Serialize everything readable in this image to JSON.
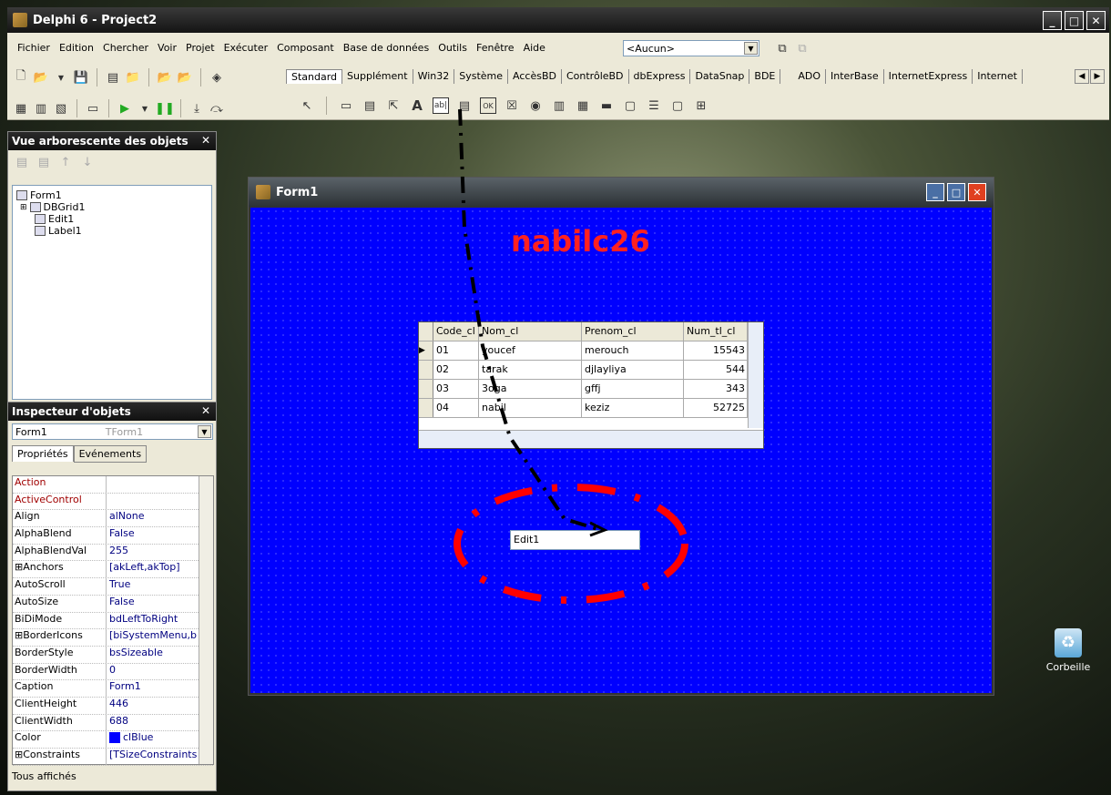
{
  "app": {
    "title": "Delphi 6 - Project2",
    "menu": [
      "Fichier",
      "Edition",
      "Chercher",
      "Voir",
      "Projet",
      "Exécuter",
      "Composant",
      "Base de données",
      "Outils",
      "Fenêtre",
      "Aide"
    ],
    "config_combo": "<Aucun>",
    "palette_tabs": [
      "Standard",
      "Supplément",
      "Win32",
      "Système",
      "AccèsBD",
      "ContrôleBD",
      "dbExpress",
      "DataSnap",
      "BDE",
      "ADO",
      "InterBase",
      "InternetExpress",
      "Internet"
    ]
  },
  "tree_panel": {
    "title": "Vue arborescente des objets",
    "items": [
      "Form1",
      "DBGrid1",
      "Edit1",
      "Label1"
    ]
  },
  "inspector": {
    "title": "Inspecteur d'objets",
    "object_name": "Form1",
    "object_type": "TForm1",
    "tabs": [
      "Propriétés",
      "Evénements"
    ],
    "properties": [
      {
        "name": "Action",
        "value": ""
      },
      {
        "name": "ActiveControl",
        "value": ""
      },
      {
        "name": "Align",
        "value": "alNone"
      },
      {
        "name": "AlphaBlend",
        "value": "False"
      },
      {
        "name": "AlphaBlendVal",
        "value": "255"
      },
      {
        "name": "⊞Anchors",
        "value": "[akLeft,akTop]"
      },
      {
        "name": "AutoScroll",
        "value": "True"
      },
      {
        "name": "AutoSize",
        "value": "False"
      },
      {
        "name": "BiDiMode",
        "value": "bdLeftToRight"
      },
      {
        "name": "⊞BorderIcons",
        "value": "[biSystemMenu,b"
      },
      {
        "name": "BorderStyle",
        "value": "bsSizeable"
      },
      {
        "name": "BorderWidth",
        "value": "0"
      },
      {
        "name": "Caption",
        "value": "Form1"
      },
      {
        "name": "ClientHeight",
        "value": "446"
      },
      {
        "name": "ClientWidth",
        "value": "688"
      },
      {
        "name": "Color",
        "value": "clBlue"
      },
      {
        "name": "⊞Constraints",
        "value": "[TSizeConstraints"
      }
    ],
    "status": "Tous affichés"
  },
  "form": {
    "title": "Form1",
    "label_text": "nabilc26",
    "edit_text": "Edit1",
    "grid": {
      "columns": [
        "Code_cl",
        "Nom_cl",
        "Prenom_cl",
        "Num_tl_cl"
      ],
      "rows": [
        [
          "01",
          "youcef",
          "merouch",
          "15543"
        ],
        [
          "02",
          "tarak",
          "djlayliya",
          "544"
        ],
        [
          "03",
          "3oga",
          "gffj",
          "343"
        ],
        [
          "04",
          "nabil",
          "keziz",
          "52725"
        ]
      ]
    }
  },
  "desktop": {
    "recycle_bin_label": "Corbeille"
  },
  "colors": {
    "form_bg": "#0000FF",
    "label_color": "#FF2020",
    "annotation_red": "#FF0000"
  }
}
